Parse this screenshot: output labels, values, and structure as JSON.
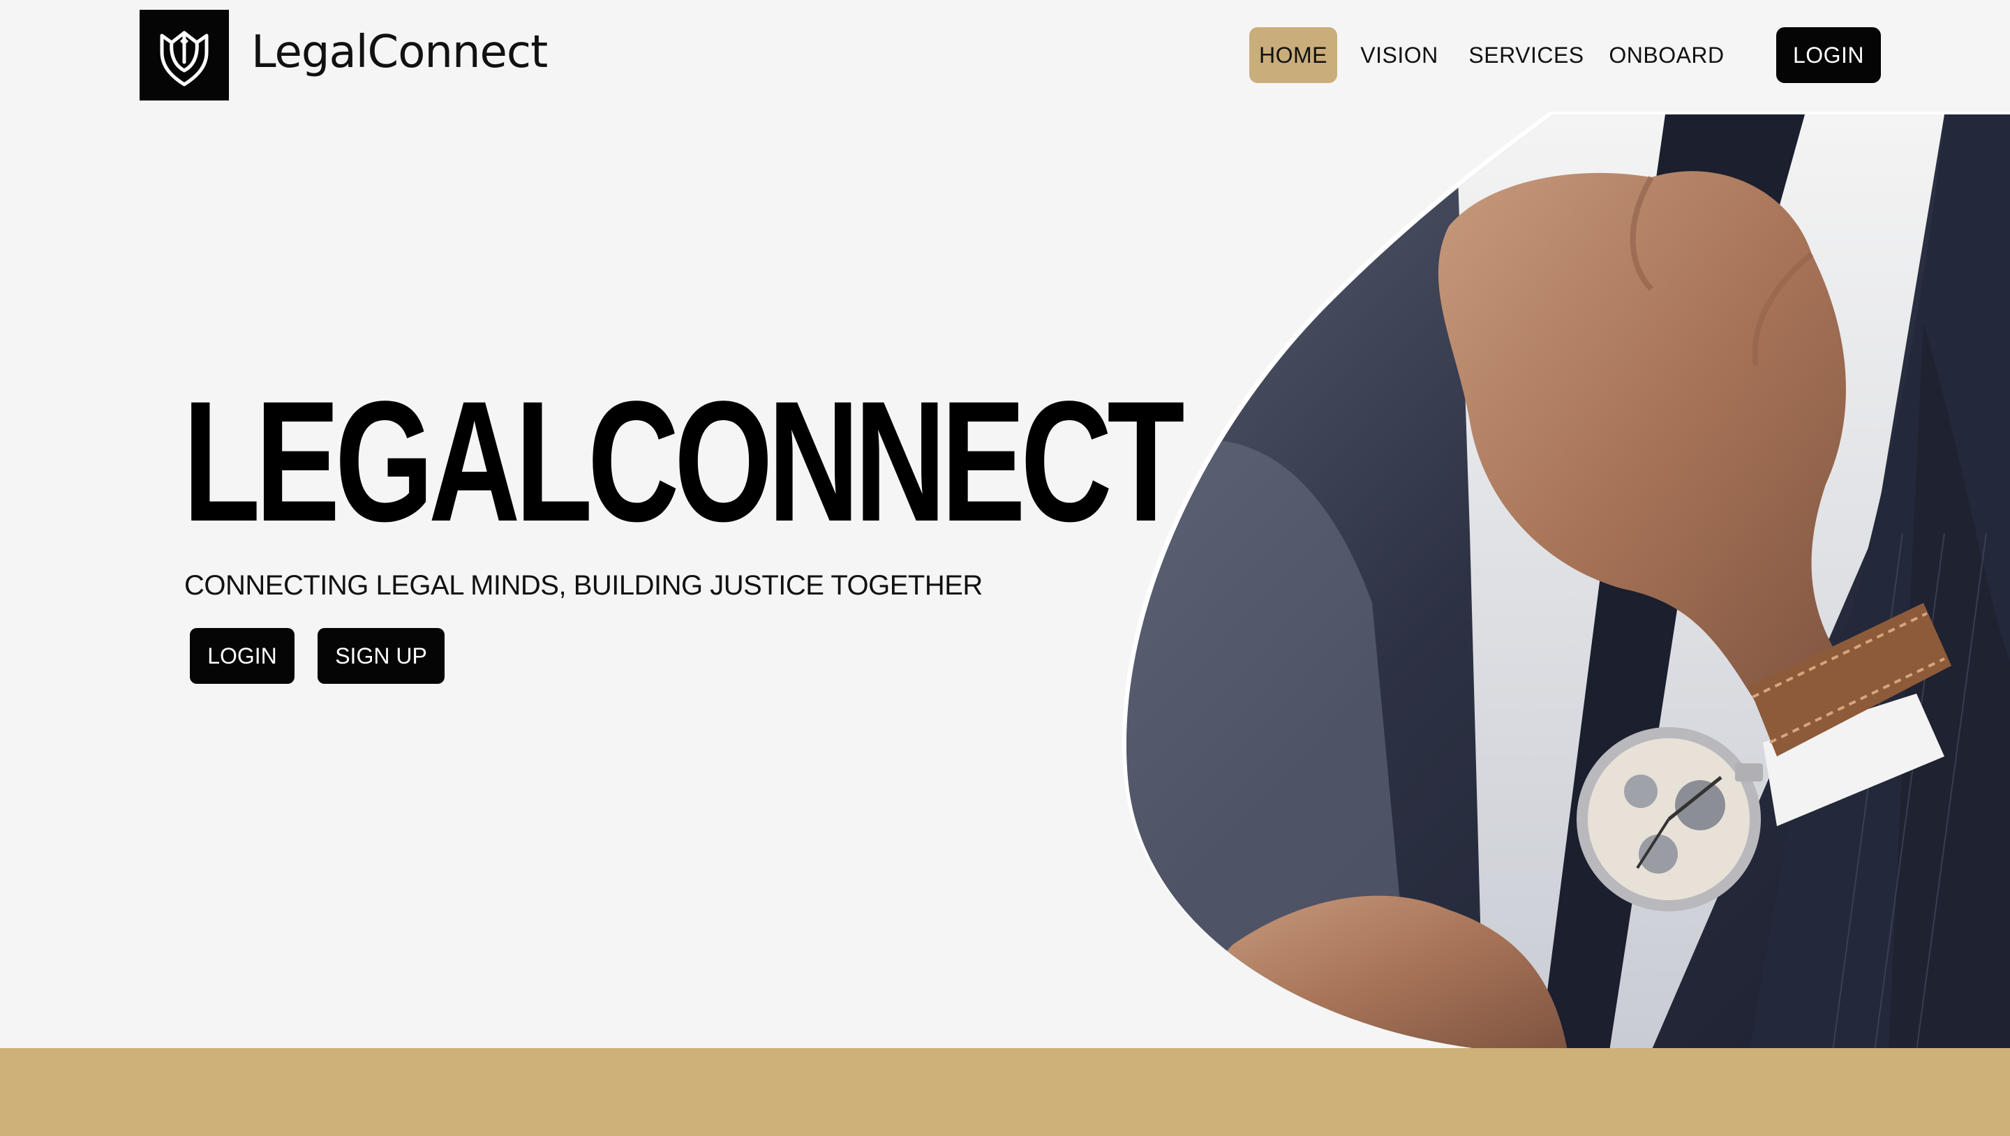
{
  "header": {
    "logo_icon": "tulip-shield-icon",
    "brand": "LegalConnect"
  },
  "nav": {
    "items": [
      {
        "label": "HOME",
        "active": true
      },
      {
        "label": "VISION"
      },
      {
        "label": "SERVICES"
      },
      {
        "label": "ONBOARD"
      },
      {
        "label": "LOGIN"
      }
    ]
  },
  "hero": {
    "title": "LEGALCONNECT",
    "tagline": "CONNECTING LEGAL MINDS, BUILDING JUSTICE TOGETHER",
    "login_label": "LOGIN",
    "signup_label": "SIGN UP"
  },
  "colors": {
    "background": "#f5f5f5",
    "accent_gold": "#c9ad7b",
    "band_gold": "#ceb079",
    "button_dark": "#050505"
  }
}
